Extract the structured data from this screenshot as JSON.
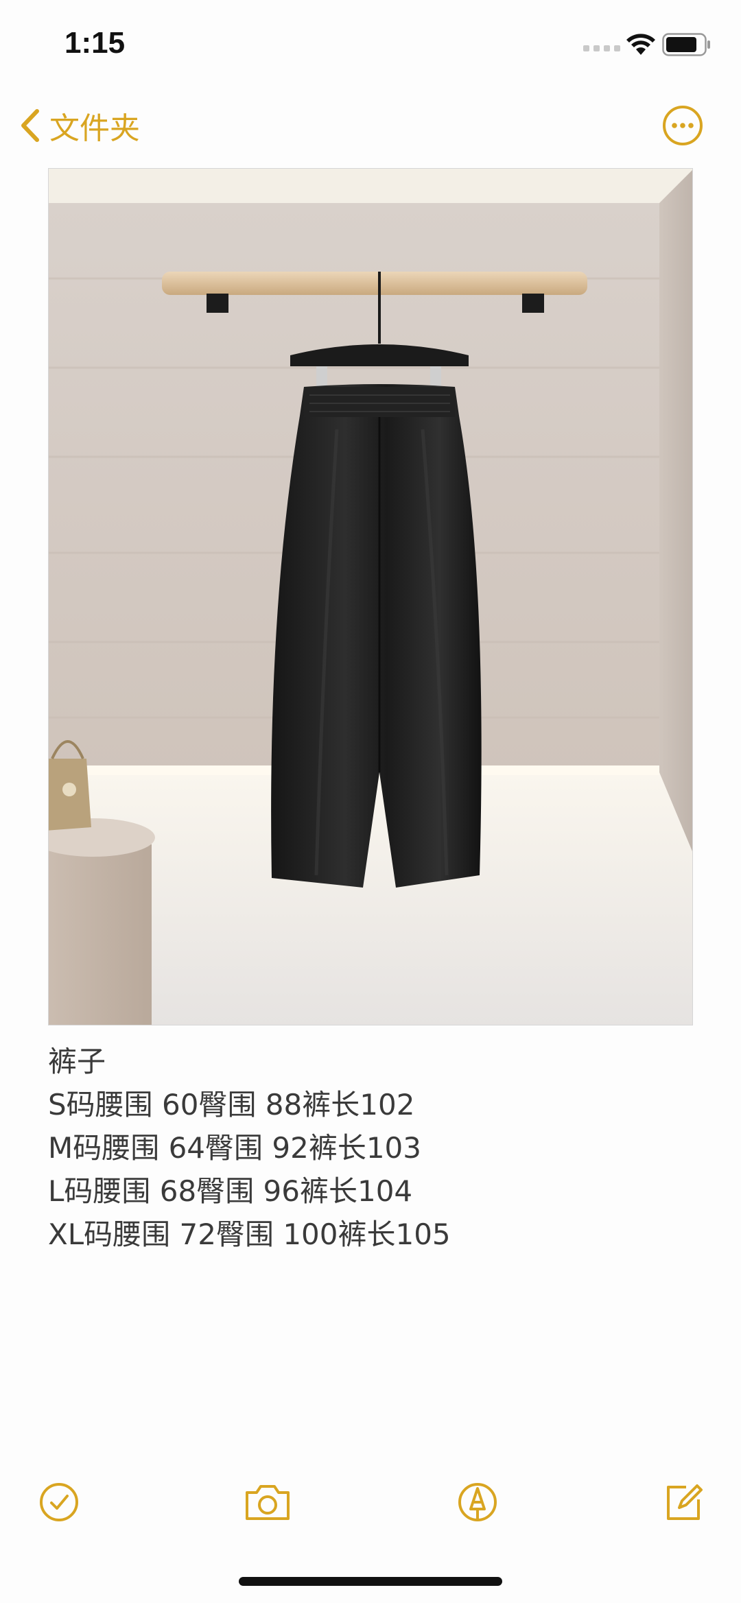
{
  "status_bar": {
    "time": "1:15",
    "icons": [
      "cellular-signal-icon",
      "wifi-icon",
      "battery-icon"
    ]
  },
  "nav": {
    "back_label": "文件夹",
    "back_icon": "chevron-left-icon",
    "more_icon": "ellipsis-circle-icon",
    "accent_color": "#d9a521"
  },
  "note": {
    "image_alt": "pants",
    "lines": [
      "裤子",
      "S码腰围 60臀围 88裤长102",
      "M码腰围 64臀围 92裤长103",
      "L码腰围 68臀围 96裤长104",
      "XL码腰围 72臀围 100裤长105"
    ]
  },
  "toolbar": {
    "items": [
      "checklist-icon",
      "camera-icon",
      "markup-pen-icon",
      "compose-icon"
    ]
  }
}
